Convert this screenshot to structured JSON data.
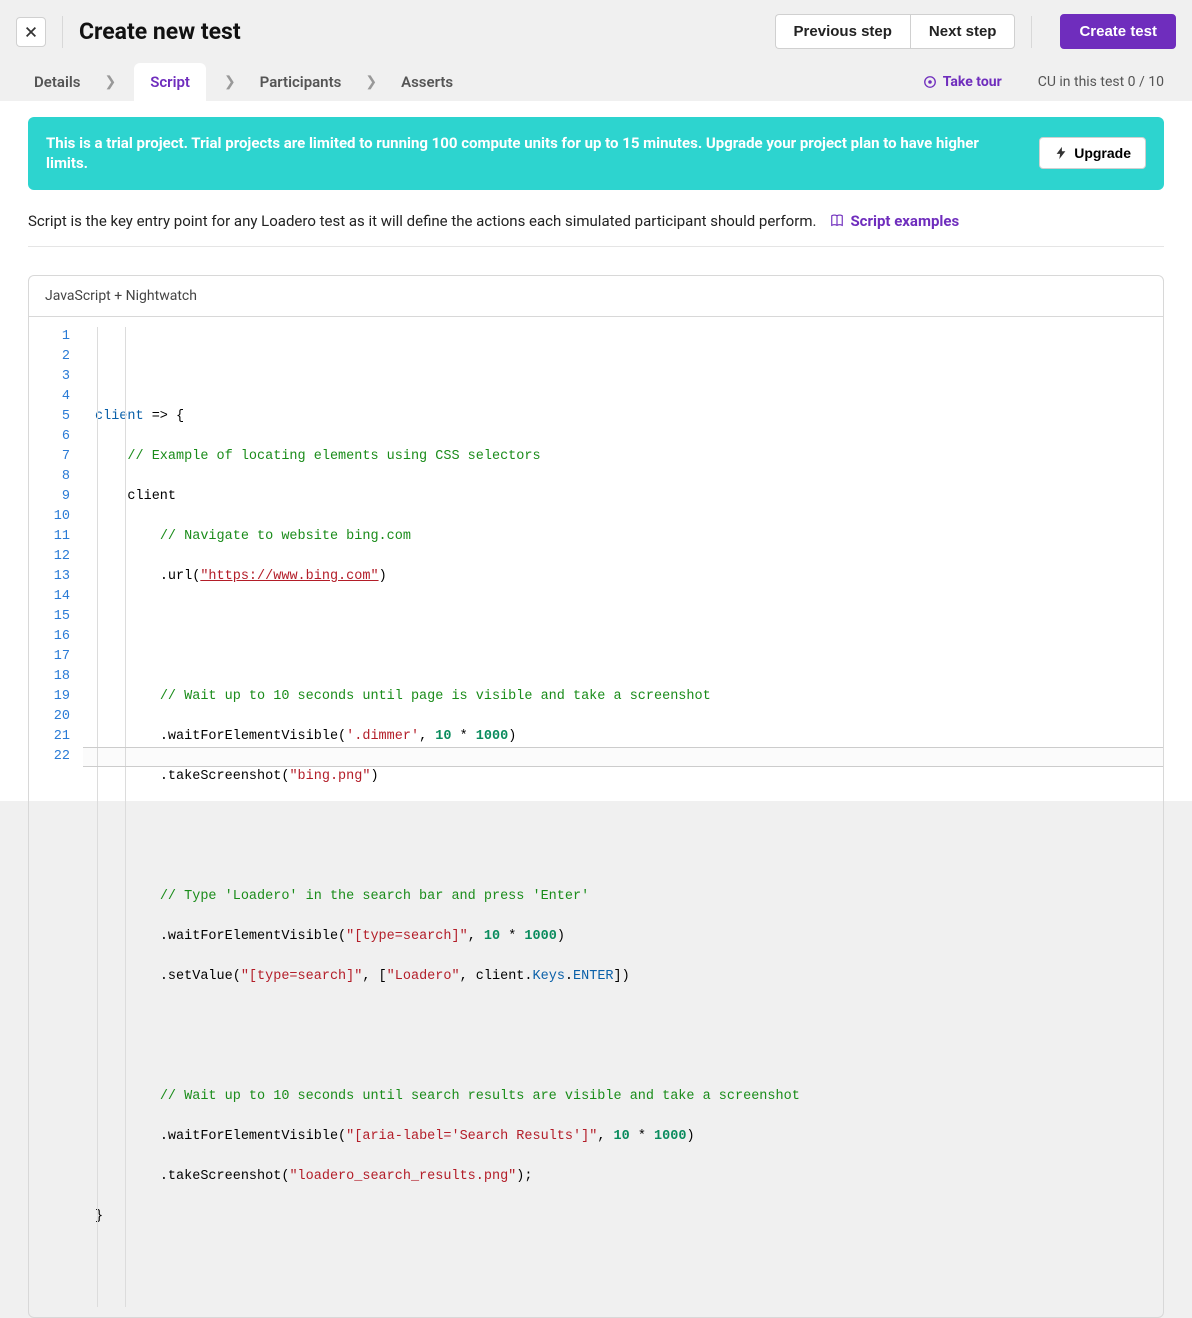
{
  "header": {
    "title": "Create new test",
    "prev": "Previous step",
    "next": "Next step",
    "create": "Create test"
  },
  "tabs": {
    "details": "Details",
    "script": "Script",
    "participants": "Participants",
    "asserts": "Asserts",
    "take_tour": "Take tour",
    "cu_label": "CU in this test 0 / 10"
  },
  "banner": {
    "text": "This is a trial project. Trial projects are limited to running 100 compute units for up to 15 minutes. Upgrade your project plan to have higher limits.",
    "upgrade": "Upgrade"
  },
  "description": {
    "text": "Script is the key entry point for any Loadero test as it will define the actions each simulated participant should perform.",
    "examples": "Script examples"
  },
  "editor": {
    "lang_label": "JavaScript + Nightwatch",
    "line_count": 22,
    "current_line": 22,
    "code": {
      "l1_a": "client",
      "l1_b": " => {",
      "l2": "// Example of locating elements using CSS selectors",
      "l3": "client",
      "l4": "// Navigate to website bing.com",
      "l5_a": ".url(",
      "l5_b": "\"https://www.bing.com\"",
      "l5_c": ")",
      "l8": "// Wait up to 10 seconds until page is visible and take a screenshot",
      "l9_a": ".waitForElementVisible(",
      "l9_b": "'.dimmer'",
      "l9_c": ", ",
      "l9_d": "10",
      "l9_e": " * ",
      "l9_f": "1000",
      "l9_g": ")",
      "l10_a": ".takeScreenshot(",
      "l10_b": "\"bing.png\"",
      "l10_c": ")",
      "l13": "// Type 'Loadero' in the search bar and press 'Enter'",
      "l14_a": ".waitForElementVisible(",
      "l14_b": "\"[type=search]\"",
      "l14_c": ", ",
      "l14_d": "10",
      "l14_e": " * ",
      "l14_f": "1000",
      "l14_g": ")",
      "l15_a": ".setValue(",
      "l15_b": "\"[type=search]\"",
      "l15_c": ", [",
      "l15_d": "\"Loadero\"",
      "l15_e": ", client.",
      "l15_f": "Keys",
      "l15_g": ".",
      "l15_h": "ENTER",
      "l15_i": "])",
      "l18": "// Wait up to 10 seconds until search results are visible and take a screenshot",
      "l19_a": ".waitForElementVisible(",
      "l19_b": "\"[aria-label='Search Results']\"",
      "l19_c": ", ",
      "l19_d": "10",
      "l19_e": " * ",
      "l19_f": "1000",
      "l19_g": ")",
      "l20_a": ".takeScreenshot(",
      "l20_b": "\"loadero_search_results.png\"",
      "l20_c": ");",
      "l21": "}"
    }
  }
}
